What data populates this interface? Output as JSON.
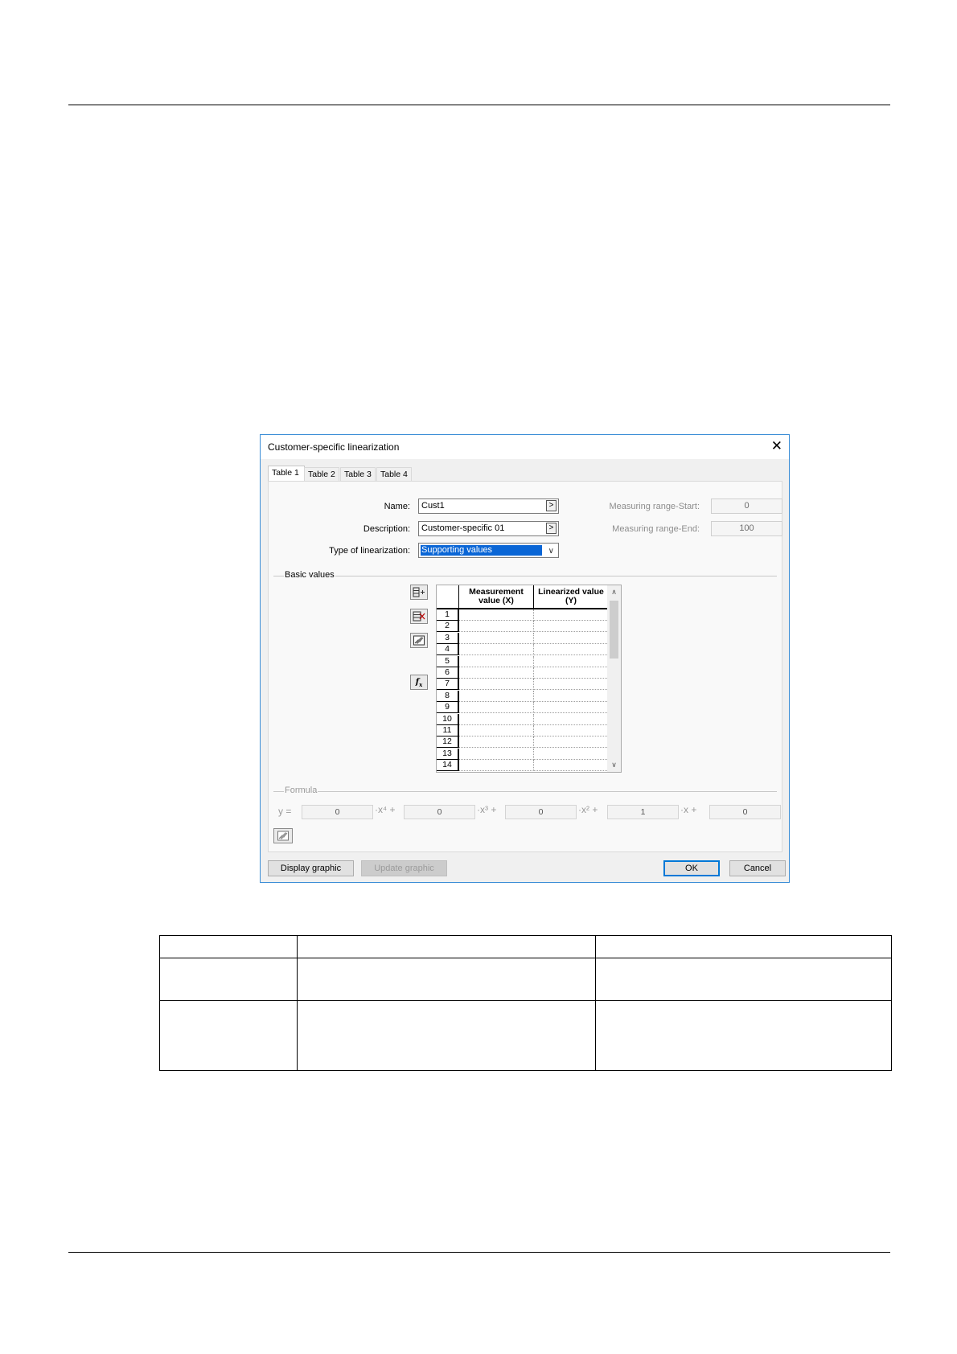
{
  "dialog": {
    "title": "Customer-specific linearization",
    "close": "✕",
    "tabs": [
      "Table 1",
      "Table 2",
      "Table 3",
      "Table 4"
    ],
    "name_label": "Name:",
    "name_value": "Cust1",
    "description_label": "Description:",
    "description_value": "Customer-specific 01",
    "browse": ">",
    "type_label": "Type of linearization:",
    "type_value": "Supporting values",
    "range_start_label": "Measuring range-Start:",
    "range_start_value": "0",
    "range_end_label": "Measuring range-End:",
    "range_end_value": "100",
    "basic_values_label": "Basic values",
    "grid": {
      "col1": "Measurement value (X)",
      "col2": "Linearized value (Y)",
      "rows": [
        "1",
        "2",
        "3",
        "4",
        "5",
        "6",
        "7",
        "8",
        "9",
        "10",
        "11",
        "12",
        "13",
        "14"
      ]
    },
    "formula": {
      "label": "Formula",
      "y": "y =",
      "coefficients": [
        "0",
        "0",
        "0",
        "1",
        "0"
      ],
      "terms": [
        "·x⁴ +",
        "·x³ +",
        "·x² +",
        "·x +"
      ]
    },
    "buttons": {
      "display_graphic": "Display graphic",
      "update_graphic": "Update graphic",
      "ok": "OK",
      "cancel": "Cancel"
    }
  }
}
